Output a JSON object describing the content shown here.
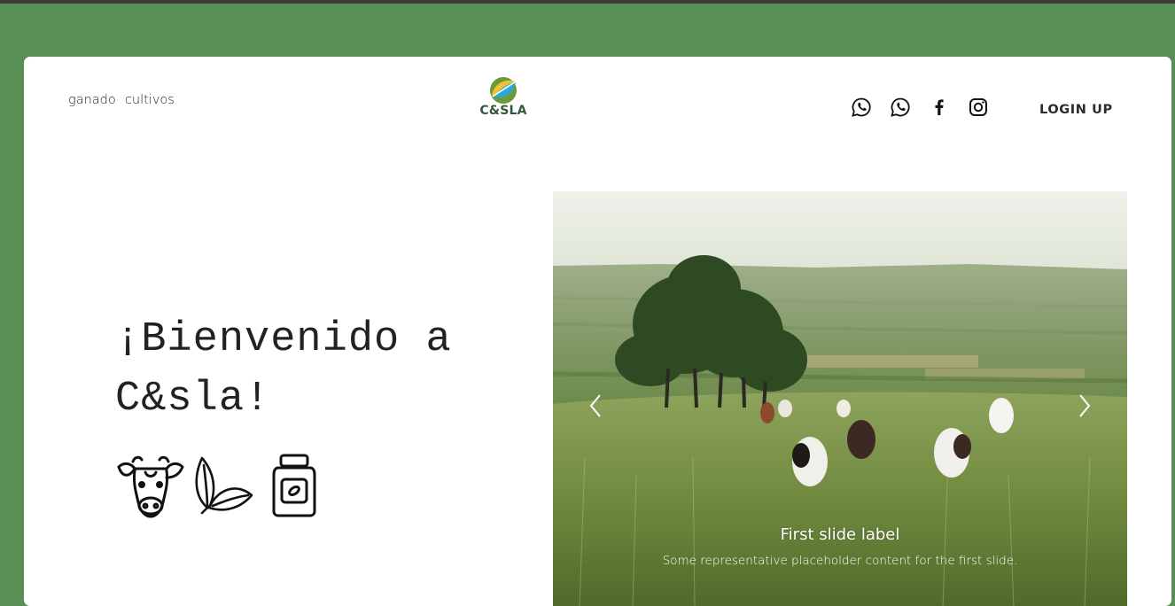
{
  "nav": {
    "links": [
      "ganado",
      "cultivos"
    ],
    "logo_text": "C&SLA",
    "social_icons": [
      "whatsapp-icon",
      "whatsapp-icon",
      "facebook-icon",
      "instagram-icon"
    ],
    "login_label": "LOGIN UP"
  },
  "hero": {
    "line1": "¡Bienvenido a",
    "line2": "C&sla!",
    "icons": [
      "cow-icon",
      "leaf-icon",
      "supplement-jar-icon"
    ]
  },
  "carousel": {
    "caption_title": "First slide label",
    "caption_text": "Some representative placeholder content for the first slide.",
    "prev_icon": "chevron-left-icon",
    "next_icon": "chevron-right-icon"
  },
  "colors": {
    "background": "#578f55",
    "card": "#ffffff",
    "logo_green": "#2f5b3a",
    "logo_yellow": "#f2c230",
    "logo_blue": "#2aa9d8"
  }
}
